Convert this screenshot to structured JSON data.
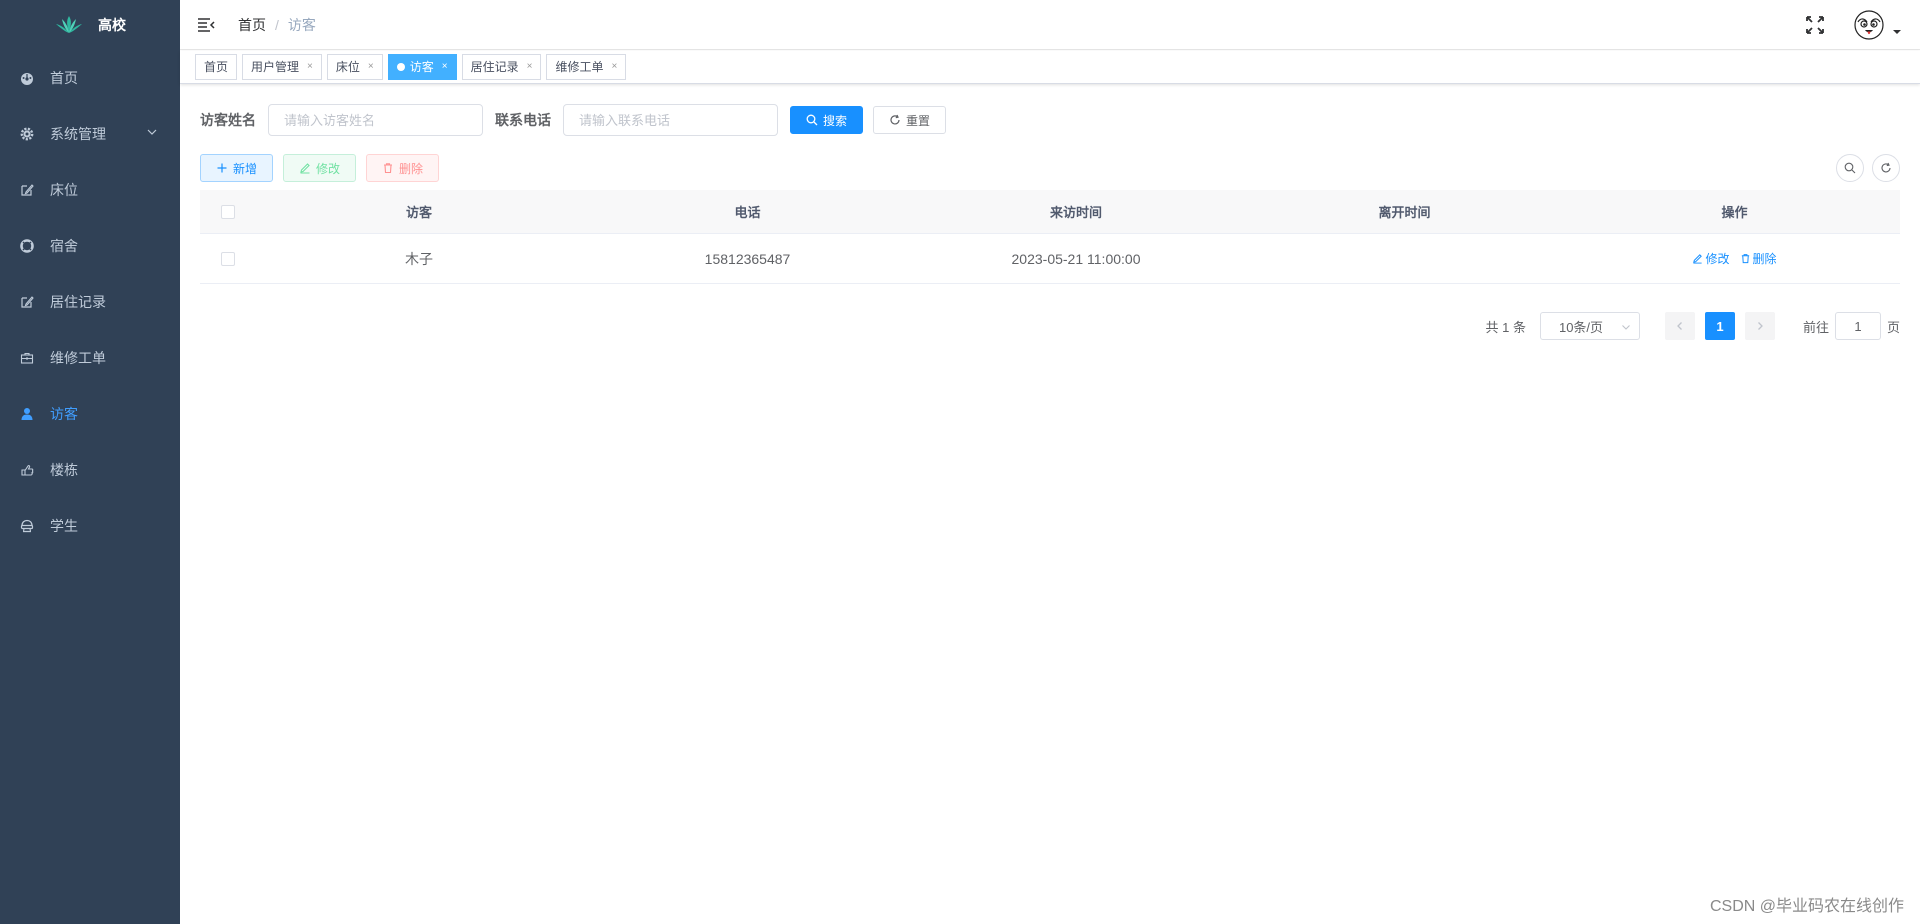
{
  "sidebar": {
    "logo_text": "高校",
    "items": [
      {
        "label": "首页",
        "icon": "dashboard-icon"
      },
      {
        "label": "系统管理",
        "icon": "gear-icon"
      },
      {
        "label": "床位",
        "icon": "edit-icon"
      },
      {
        "label": "宿舍",
        "icon": "lifebuoy-icon"
      },
      {
        "label": "居住记录",
        "icon": "edit-icon"
      },
      {
        "label": "维修工单",
        "icon": "toolbox-icon"
      },
      {
        "label": "访客",
        "icon": "user-icon"
      },
      {
        "label": "楼栋",
        "icon": "hand-icon"
      },
      {
        "label": "学生",
        "icon": "student-icon"
      }
    ],
    "active_color": "#409eff"
  },
  "navbar": {
    "breadcrumb_home": "首页",
    "breadcrumb_sep": "/",
    "breadcrumb_current": "访客"
  },
  "tags": [
    {
      "label": "首页"
    },
    {
      "label": "用户管理"
    },
    {
      "label": "床位"
    },
    {
      "label": "访客",
      "active": true
    },
    {
      "label": "居住记录"
    },
    {
      "label": "维修工单"
    }
  ],
  "search": {
    "visitor_name_label": "访客姓名",
    "visitor_name_placeholder": "请输入访客姓名",
    "phone_label": "联系电话",
    "phone_placeholder": "请输入联系电话",
    "search_button": "搜索",
    "reset_button": "重置"
  },
  "toolbar": {
    "add_label": "新增",
    "edit_label": "修改",
    "delete_label": "删除"
  },
  "table": {
    "columns": [
      "访客",
      "电话",
      "来访时间",
      "离开时间",
      "操作"
    ],
    "rows": [
      {
        "visitor": "木子",
        "phone": "15812365487",
        "visit_time": "2023-05-21 11:00:00",
        "leave_time": "",
        "edit": "修改",
        "delete": "删除"
      }
    ]
  },
  "pagination": {
    "total_text": "共 1 条",
    "page_size": "10条/页",
    "current_page": "1",
    "goto_label": "前往",
    "goto_value": "1",
    "goto_suffix": "页"
  },
  "watermark": "CSDN @毕业码农在线创作"
}
